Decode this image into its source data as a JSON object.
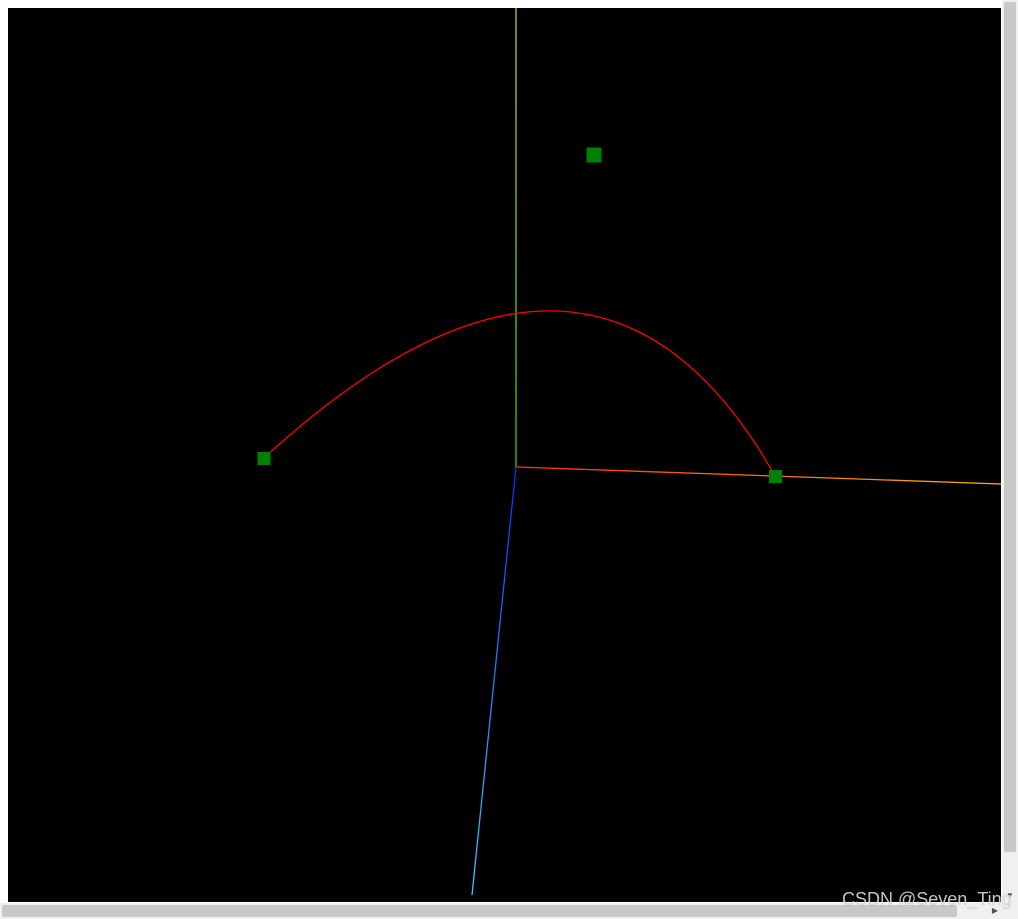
{
  "watermark": {
    "text": "CSDN @Seven_Ting"
  },
  "scene": {
    "background": "#000000",
    "axis_colors": {
      "x_start": "#ff3300",
      "x_end": "#ffb000",
      "y_start": "#33cc00",
      "y_end": "#cccc00",
      "z_start": "#0033ff",
      "z_end": "#33ccff"
    },
    "curve_color": "#ff0000",
    "control_point_color": "#008000",
    "control_point_count": 3,
    "curve_type": "quadratic-bezier"
  }
}
